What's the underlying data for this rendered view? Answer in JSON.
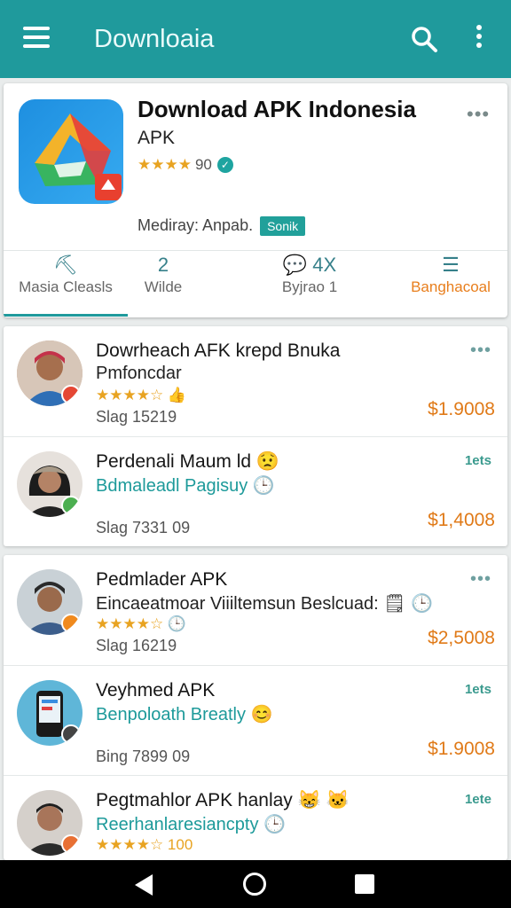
{
  "appbar": {
    "title": "Downloaia",
    "menu_icon": "menu-icon",
    "search_icon": "search-icon",
    "more_icon": "more-vert-icon"
  },
  "hero": {
    "title": "Download APK Indonesia",
    "subtitle": "APK",
    "stars": "★★★★",
    "rating": "90",
    "developer": "Mediray: Anpab.",
    "badge": "Sonik",
    "more": "•••"
  },
  "tabs": [
    {
      "icon": "⛏",
      "label": "Masia Cleasls"
    },
    {
      "icon": "2",
      "label": "Wilde"
    },
    {
      "icon": "💬 4X",
      "label": "Byjrao     1"
    },
    {
      "icon": "☰",
      "label": "Banghacoal"
    }
  ],
  "colors": {
    "primary": "#1f9a9c",
    "accent": "#e87e1c",
    "star": "#e8a321"
  },
  "list": [
    {
      "title": "Dowrheach AFK krepd Bnuka",
      "subtitle": "Pmfoncdar",
      "stars": "★★★★☆ 👍",
      "meta": "Slag 15219",
      "price": "$1.9008",
      "corner": "•••"
    },
    {
      "title": "Perdenali Maum ld 😟",
      "subtitle": "Bdmaleadl Pagisuy 🕒",
      "stars": "",
      "meta": "Slag 7331 09",
      "price": "$1,4008",
      "corner": "1ets"
    },
    {
      "title": "Pedmlader APK",
      "subtitle": "Eincaeatmoar Viiiltemsun Beslcuad: 🗒 🕒",
      "stars": "★★★★☆ 🕒",
      "meta": "Slag 16219",
      "price": "$2,5008",
      "corner": "•••"
    },
    {
      "title": "Veyhmed APK",
      "subtitle": "Benpoloath Breatly 😊",
      "stars": "",
      "meta": "Bing 7899 09",
      "price": "$1.9008",
      "corner": "1ets"
    },
    {
      "title": "Pegtmahlor APK hanlay 😸 🐱",
      "subtitle": "Reerhanlaresiancpty 🕒",
      "stars": "★★★★☆ 100",
      "meta": "",
      "price": "",
      "corner": "1ete"
    }
  ]
}
